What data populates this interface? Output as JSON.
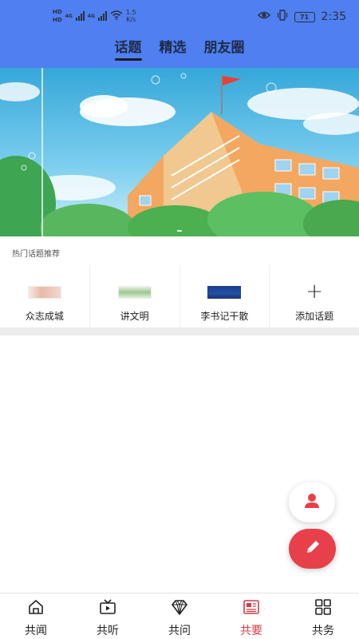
{
  "status_bar": {
    "hd1": "HD",
    "hd2": "HD",
    "sim1": "4G",
    "sim2": "4G",
    "net_speed": "1.5",
    "net_unit": "K/s",
    "battery": "71",
    "time": "2:35"
  },
  "tabs": [
    {
      "label": "话题",
      "active": true
    },
    {
      "label": "精选",
      "active": false
    },
    {
      "label": "朋友圈",
      "active": false
    }
  ],
  "hot_topics": {
    "title": "热门话题推荐",
    "items": [
      {
        "label": "众志成城"
      },
      {
        "label": "讲文明"
      },
      {
        "label": "李书记干散"
      },
      {
        "label": "添加话题"
      }
    ]
  },
  "bottom_nav": [
    {
      "label": "共闻",
      "icon": "home-icon",
      "active": false
    },
    {
      "label": "共听",
      "icon": "video-icon",
      "active": false
    },
    {
      "label": "共问",
      "icon": "diamond-icon",
      "active": false
    },
    {
      "label": "共要",
      "icon": "newspaper-icon",
      "active": true
    },
    {
      "label": "共务",
      "icon": "grid-icon",
      "active": false
    }
  ],
  "colors": {
    "header_bg": "#4f7ff0",
    "accent_red": "#e8404a",
    "active_nav": "#d73c45"
  }
}
